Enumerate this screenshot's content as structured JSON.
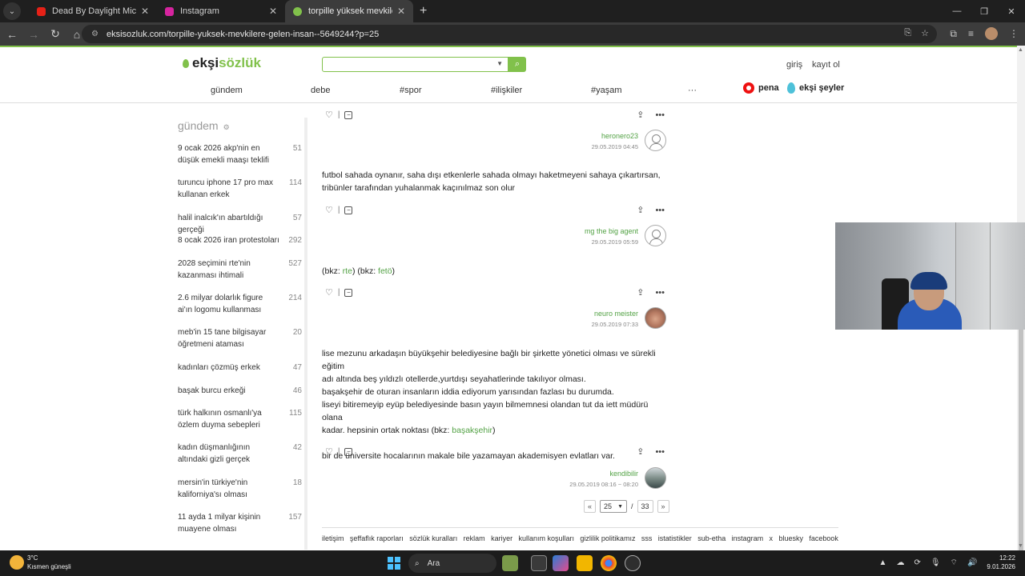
{
  "browser": {
    "tabs": [
      {
        "title": "Dead By Daylight Michael Myers",
        "favicon_color": "#e62117",
        "active": false
      },
      {
        "title": "Instagram",
        "favicon_color": "#d6249f",
        "active": false
      },
      {
        "title": "torpille yüksek mevkilere gelen",
        "favicon_color": "#81c14b",
        "active": true
      }
    ],
    "url": "eksisozluk.com/torpille-yuksek-mevkilere-gelen-insan--5649244?p=25"
  },
  "site": {
    "logo_prefix": "ekşi",
    "logo_suffix": "sözlük",
    "search_placeholder": "",
    "auth": {
      "login": "giriş",
      "register": "kayıt ol"
    },
    "nav": [
      "gündem",
      "debe",
      "#spor",
      "#ilişkiler",
      "#yaşam",
      "···"
    ],
    "pena": "pena",
    "eksi_seyler": "ekşi şeyler",
    "accent": "#81c14b"
  },
  "sidebar": {
    "title": "gündem",
    "items": [
      {
        "title": "9 ocak 2026 akp'nin en düşük emekli maaşı teklifi",
        "count": "51"
      },
      {
        "title": "turuncu iphone 17 pro max kullanan erkek",
        "count": "114"
      },
      {
        "title": "halil inalcık'ın abartıldığı gerçeği",
        "count": "57"
      },
      {
        "title": "8 ocak 2026 iran protestoları",
        "count": "292"
      },
      {
        "title": "2028 seçimini rte'nin kazanması ihtimali",
        "count": "527"
      },
      {
        "title": "2.6 milyar dolarlık figure ai'ın logomu kullanması",
        "count": "214"
      },
      {
        "title": "meb'in 15 tane bilgisayar öğretmeni ataması",
        "count": "20"
      },
      {
        "title": "kadınları çözmüş erkek",
        "count": "47"
      },
      {
        "title": "başak burcu erkeği",
        "count": "46"
      },
      {
        "title": "türk halkının osmanlı'ya özlem duyma sebepleri",
        "count": "115"
      },
      {
        "title": "kadın düşmanlığının altındaki gizli gerçek",
        "count": "42"
      },
      {
        "title": "mersin'in türkiye'nin kaliforniya'sı olması",
        "count": "18"
      },
      {
        "title": "11 ayda 1 milyar kişinin muayene olması",
        "count": "157"
      }
    ]
  },
  "entries": [
    {
      "text_lines": [],
      "author": "heronero23",
      "date": "29.05.2019 04:45",
      "avatar": "default"
    },
    {
      "text_lines": [
        "futbol sahada oynanır, saha dışı etkenlerle sahada olmayı haketmeyeni sahaya çıkartırsan,",
        "tribünler tarafından yuhalanmak kaçınılmaz son olur"
      ],
      "author": "mg the big agent",
      "date": "29.05.2019 05:59",
      "avatar": "default"
    },
    {
      "bkz_prefix": "(bkz: ",
      "bkz1": "rte",
      "bkz_mid": ") (bkz: ",
      "bkz2": "fetö",
      "bkz_suffix": ")",
      "author": "neuro meister",
      "date": "29.05.2019 07:33",
      "avatar": "cat"
    },
    {
      "text_lines": [
        "lise mezunu arkadaşın büyükşehir belediyesine bağlı bir şirkette yönetici olması ve sürekli eğitim",
        "adı altında beş yıldızlı otellerde,yurtdışı seyahatlerinde takılıyor olması.",
        "başakşehir de oturan insanların iddia ediyorum yarısından fazlası bu durumda.",
        "liseyi bitiremeyip eyüp belediyesinde basın yayın bilmemnesi olandan tut da iett müdürü olana"
      ],
      "last_prefix": "kadar. hepsinin ortak noktası (bkz: ",
      "last_link": "başakşehir",
      "last_suffix": ")",
      "closing": "bir de üniversite hocalarının makale bile yazamayan akademisyen evlatları var.",
      "author": "kendibilir",
      "date": "29.05.2019 08:16 ~ 08:20",
      "avatar": "scene"
    }
  ],
  "pager": {
    "prev": "«",
    "current": "25",
    "separator": "/",
    "total": "33",
    "next": "»"
  },
  "footer": [
    "iletişim",
    "şeffaflık raporları",
    "sözlük kuralları",
    "reklam",
    "kariyer",
    "kullanım koşulları",
    "gizlilik politikamız",
    "sss",
    "istatistikler",
    "sub-etha",
    "instagram",
    "x",
    "bluesky",
    "facebook"
  ],
  "taskbar": {
    "temperature": "3°C",
    "weather": "Kısmen güneşli",
    "search": "Ara",
    "time": "12:22",
    "date": "9.01.2026"
  }
}
